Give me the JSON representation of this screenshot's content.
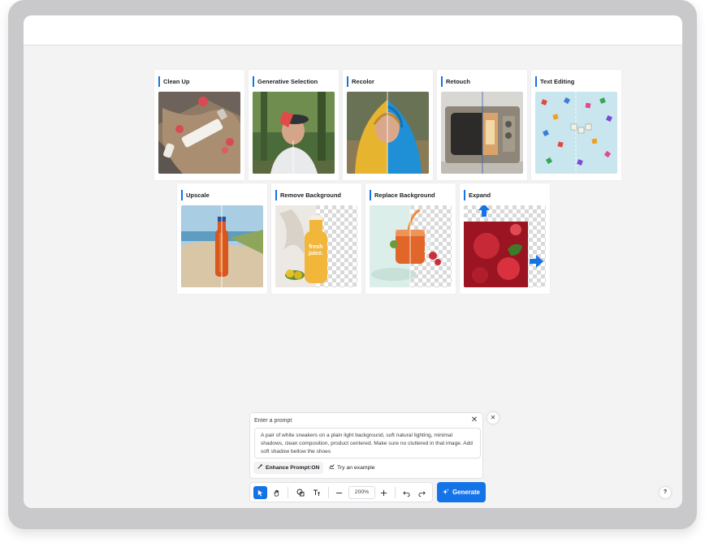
{
  "features_row1": [
    {
      "label": "Clean Up"
    },
    {
      "label": "Generative Selection"
    },
    {
      "label": "Recolor"
    },
    {
      "label": "Retouch"
    },
    {
      "label": "Text Editing"
    }
  ],
  "features_row2": [
    {
      "label": "Upscale"
    },
    {
      "label": "Remove Background"
    },
    {
      "label": "Replace Background"
    },
    {
      "label": "Expand"
    }
  ],
  "thumb_overlays": {
    "fresh_line1": "fresh",
    "fresh_line2": "juice."
  },
  "prompt": {
    "title": "Enter a prompt",
    "text": "A pair of white sneakers on a plain light background, soft natural lighting, minimal shadows, clean composition, product centered. Make sure no cluttered in that image. Add soft shadow bellow the shoes",
    "enhance_label": "Enhance Prompt:ON",
    "try_example_label": "Try an example"
  },
  "toolbar": {
    "zoom": "200%"
  },
  "generate_label": "Generate",
  "help_label": "?",
  "colors": {
    "accent": "#1473e6",
    "canvas": "#f3f3f4",
    "device_frame": "#c9c9cb"
  },
  "icons": {
    "close": "close-icon",
    "enhance": "magic-wand-icon",
    "try_example": "example-icon",
    "select": "pointer-icon",
    "hand": "hand-icon",
    "shapes": "shapes-icon",
    "text": "text-tool-icon",
    "zoom_out": "minus-icon",
    "zoom_in": "plus-icon",
    "undo": "undo-icon",
    "redo": "redo-icon",
    "generate": "sparkle-icon"
  }
}
